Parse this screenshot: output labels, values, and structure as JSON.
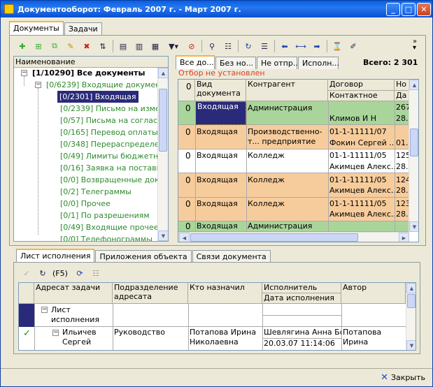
{
  "title": "Документооборот: Февраль 2007 г. - Март 2007 г.",
  "main_tabs": [
    "Документы",
    "Задачи"
  ],
  "tree": {
    "header": "Наименование",
    "root": "[1/10290] Все документы",
    "incoming": "[0/6239] Входящие документы",
    "items": [
      "[0/2301] Входящая",
      "[0/2339] Письмо на измен...",
      "[0/57] Письма на согласо...",
      "[0/165] Перевод оплаты",
      "[0/348] Перераспределен...",
      "[0/49] Лимиты бюджетных...",
      "[0/16] Заявка на поставку...",
      "[0/0] Возвращенные доку...",
      "[0/2] Телеграммы",
      "[0/0] Прочее",
      "[0/1] По разрешениям",
      "[0/49] Входящие  прочее",
      "[0/0] Телефонограммы"
    ]
  },
  "filter_tabs": [
    "Все до...",
    "Без но...",
    "Не отпр...",
    "Исполн..."
  ],
  "total": "Всего: 2 301",
  "filter_status": "Отбор не установлен",
  "grid_headers": {
    "type": "Вид документа",
    "contractor": "Контрагент",
    "contract": "Договор",
    "contact": "Контактное лицо",
    "num": "Но",
    "date": "Да"
  },
  "rows": [
    {
      "color": "green",
      "type": "Входящая",
      "contractor": "Администрация",
      "contract": "",
      "contact": "Климов И Н",
      "num": "267",
      "date": "28."
    },
    {
      "color": "orange",
      "type": "Входящая",
      "contractor": "Производственно-т... предприятие",
      "contract": "01-1-11111/07",
      "contact": "Фокин Сергей ...",
      "num": "",
      "date": "01."
    },
    {
      "color": "white",
      "type": "Входящая",
      "contractor": "Колледж",
      "contract": "01-1-11111/05",
      "contact": "Акимцев Алекс...",
      "num": "125",
      "date": "28."
    },
    {
      "color": "orange",
      "type": "Входящая",
      "contractor": "Колледж",
      "contract": "01-1-11111/05",
      "contact": "Акимцев Алекс...",
      "num": "124",
      "date": "28."
    },
    {
      "color": "orange",
      "type": "Входящая",
      "contractor": "Колледж",
      "contract": "01-1-11111/05",
      "contact": "Акимцев Алекс...",
      "num": "123",
      "date": "28."
    },
    {
      "color": "green",
      "type": "Входящая",
      "contractor": "Администрация",
      "contract": "",
      "contact": "",
      "num": "",
      "date": ""
    }
  ],
  "bottom_tabs": [
    "Лист исполнения",
    "Приложения объекта",
    "Связи документа"
  ],
  "bottom_toolbar": {
    "f5": "(F5)"
  },
  "bottom_headers": {
    "addressee": "Адресат задачи",
    "dept": "Подразделение адресата",
    "assigned": "Кто назначил",
    "executor": "Исполнитель",
    "exec_date": "Дата исполнения",
    "author": "Автор"
  },
  "bottom_rows": [
    {
      "addressee": "Лист исполнения",
      "dept": "",
      "assigned": "",
      "executor": "",
      "exec_date": "",
      "author": ""
    },
    {
      "addressee": "Ильичев Сергей",
      "dept": "Руководство",
      "assigned": "Потапова Ирина Николаевна",
      "executor": "Шевлягина Анна Бо...",
      "exec_date": "20.03.07 11:14:06",
      "author": "Потапова Ирина Николаевна"
    }
  ],
  "close_label": "Закрыть",
  "colors": {
    "green_row": "#a9d59a",
    "orange_row": "#f7cc9c",
    "tree_green": "#2e8b2e",
    "selected": "#2a2a7a"
  }
}
